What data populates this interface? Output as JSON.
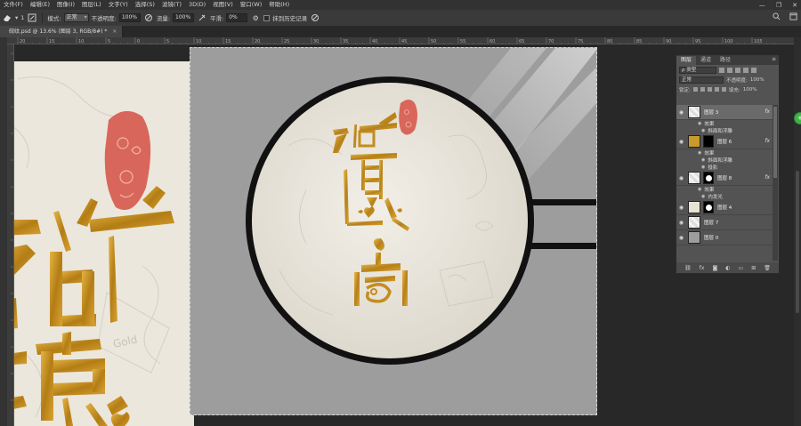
{
  "menubar": {
    "items": [
      "文件(F)",
      "编辑(E)",
      "图像(I)",
      "图层(L)",
      "文字(Y)",
      "选择(S)",
      "滤镜(T)",
      "3D(D)",
      "视图(V)",
      "窗口(W)",
      "帮助(H)"
    ],
    "window_controls": [
      "minimize-icon",
      "restore-icon",
      "close-icon"
    ]
  },
  "options": {
    "brush_size": "1",
    "mode_label": "模式:",
    "mode_value": "正常",
    "opacity_label": "不透明度:",
    "opacity_value": "100%",
    "flow_label": "流量:",
    "flow_value": "100%",
    "smoothing_label": "平滑:",
    "smoothing_value": "0%",
    "history_label": "抹到历史记录"
  },
  "document_tab": {
    "title": "砚纹.psd @ 13.6% (图层 3, RGB/8#) *",
    "close": "×"
  },
  "ruler": {
    "ticks": [
      "20",
      "15",
      "10",
      "5",
      "0",
      "5",
      "10",
      "15",
      "20",
      "25",
      "30",
      "35",
      "40",
      "45",
      "50",
      "55",
      "60",
      "65",
      "70",
      "75",
      "80",
      "85",
      "90",
      "95",
      "100",
      "105"
    ]
  },
  "layers_panel": {
    "tabs": [
      "图层",
      "通道",
      "路径"
    ],
    "active_tab": "图层",
    "kind_filter": "类型",
    "blend_mode": "正常",
    "opacity_label": "不透明度:",
    "opacity_value": "100%",
    "lock_label": "锁定:",
    "fill_label": "填充:",
    "fill_value": "100%",
    "layers": [
      {
        "name": "图层 3",
        "selected": true,
        "fx": "fx",
        "effects_label": "效果",
        "effects": [
          "斜面和浮雕"
        ]
      },
      {
        "name": "图层 6",
        "selected": false,
        "fx": "fx",
        "effects_label": "效果",
        "effects": [
          "斜面和浮雕",
          "投影"
        ]
      },
      {
        "name": "图层 8",
        "selected": false,
        "fx": "fx",
        "effects_label": "效果",
        "effects": [
          "内发光"
        ]
      },
      {
        "name": "图层 4",
        "selected": false,
        "fx": "",
        "effects_label": "",
        "effects": []
      },
      {
        "name": "图层 7",
        "selected": false,
        "fx": "",
        "effects_label": "",
        "effects": []
      },
      {
        "name": "图层 0",
        "selected": false,
        "fx": "",
        "effects_label": "",
        "effects": []
      }
    ],
    "footer_icons": [
      "link-icon",
      "fx-icon",
      "mask-icon",
      "adjustment-icon",
      "group-icon",
      "new-layer-icon",
      "delete-icon"
    ]
  },
  "colors": {
    "accent_gold": "#c8951e",
    "seal_red": "#d9655a",
    "paper": "#e9e5da",
    "canvas_gray": "#9d9d9d",
    "ring": "#111111"
  }
}
